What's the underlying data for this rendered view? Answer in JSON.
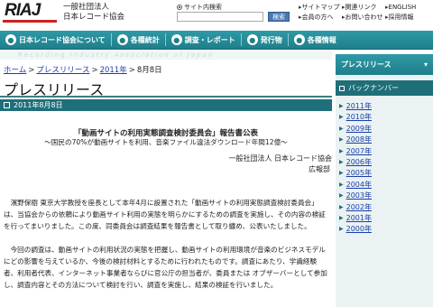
{
  "header": {
    "logo": "RIAJ",
    "org_line1": "一般社団法人",
    "org_line2": "日本レコード協会",
    "search_option": "サイト内検索",
    "search_placeholder": "",
    "search_button": "検索",
    "links": [
      "サイトマップ",
      "関連リンク",
      "ENGLISH",
      "会員の方へ",
      "お問い合わせ",
      "採用情報"
    ]
  },
  "nav": {
    "items": [
      {
        "label": "日本レコード協会について",
        "icon": "circle-icon"
      },
      {
        "label": "各種統計",
        "icon": "circle-icon"
      },
      {
        "label": "調査・レポート",
        "icon": "circle-icon"
      },
      {
        "label": "発行物",
        "icon": "circle-icon"
      },
      {
        "label": "各種情報",
        "icon": "circle-icon"
      }
    ]
  },
  "banner": "Recording Industry Association of Japan",
  "breadcrumb": {
    "home": "ホーム",
    "press": "プレスリリース",
    "year": "2011年",
    "current": "8月8日"
  },
  "page_title": "プレスリリース",
  "date_bar": "2011年8月8日",
  "article": {
    "heading": "「動画サイトの利用実態調査検討委員会」報告書公表",
    "subheading": "〜国民の70%が動画サイトを利用、音楽ファイル違法ダウンロード年間12億〜",
    "signature_org": "一般社団法人 日本レコード協会",
    "signature_dept": "広報部",
    "para1": "　濱野保樹 東京大学教授を座長として本年4月に設置された「動画サイトの利用実態調査検討委員会」は、当協会からの依頼により動画サイト利用の実態を明らかにするための調査を実施し、その内容の検証を行ってまいりました。この度、同委員会は調査結果を報告書として取り纏め、公表いたしました。",
    "para2": "　今回の調査は、動画サイトの利用状況の実態を把握し、動画サイトの利用環境が音楽のビジネスモデルにどの影響を与えているか、今後の検討材料とするために行われたものです。調査にあたり、学識経験者、利用者代表、インターネット事業者ならびに官公庁の担当者が、委員または オブザーバーとして参加し、調査内容とその方法について検討を行い、調査を実施し、結果の検証を行いました。"
  },
  "sidebar": {
    "title": "プレスリリース",
    "subtitle": "バックナンバー",
    "years": [
      "2011年",
      "2010年",
      "2009年",
      "2008年",
      "2007年",
      "2006年",
      "2005年",
      "2004年",
      "2003年",
      "2002年",
      "2001年",
      "2000年"
    ]
  },
  "colors": {
    "teal": "#1f7f8b",
    "dark_teal": "#1f6f79",
    "link": "#1a3fa8",
    "logo_red": "#cc2222"
  }
}
